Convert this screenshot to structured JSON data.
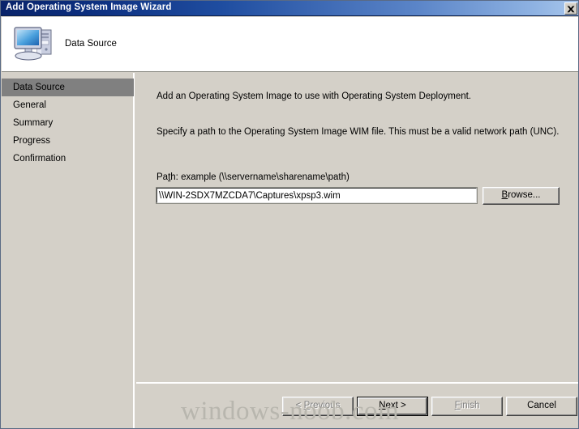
{
  "window": {
    "title": "Add Operating System Image Wizard",
    "close_icon": "close-icon"
  },
  "header": {
    "icon": "computer-icon",
    "title": "Data Source"
  },
  "sidebar": {
    "items": [
      {
        "label": "Data Source",
        "selected": true
      },
      {
        "label": "General",
        "selected": false
      },
      {
        "label": "Summary",
        "selected": false
      },
      {
        "label": "Progress",
        "selected": false
      },
      {
        "label": "Confirmation",
        "selected": false
      }
    ]
  },
  "content": {
    "intro_text": "Add an Operating System Image to use with Operating System Deployment.",
    "specify_text": "Specify a path to the Operating System Image WIM file. This must be a valid network path (UNC).",
    "path_label_before": "Pa",
    "path_label_accel": "t",
    "path_label_after": "h: example (\\\\servername\\sharename\\path)",
    "path_value": "\\\\WIN-2SDX7MZCDA7\\Captures\\xpsp3.wim",
    "browse_before": "",
    "browse_accel": "B",
    "browse_after": "rowse..."
  },
  "footer": {
    "previous": {
      "before": "< ",
      "accel": "P",
      "after": "revious",
      "disabled": true
    },
    "next": {
      "before": "",
      "accel": "N",
      "after": "ext >",
      "disabled": false,
      "default": true
    },
    "finish": {
      "before": "",
      "accel": "F",
      "after": "inish",
      "disabled": true
    },
    "cancel": {
      "before": "",
      "accel": "",
      "after": "Cancel",
      "disabled": false
    }
  },
  "watermark": {
    "text": "windows-noob.com"
  },
  "colors": {
    "title_start": "#0a246a",
    "title_end": "#a8c6ec",
    "face": "#d4d0c8",
    "selection": "#808080",
    "field": "#ffffff"
  }
}
